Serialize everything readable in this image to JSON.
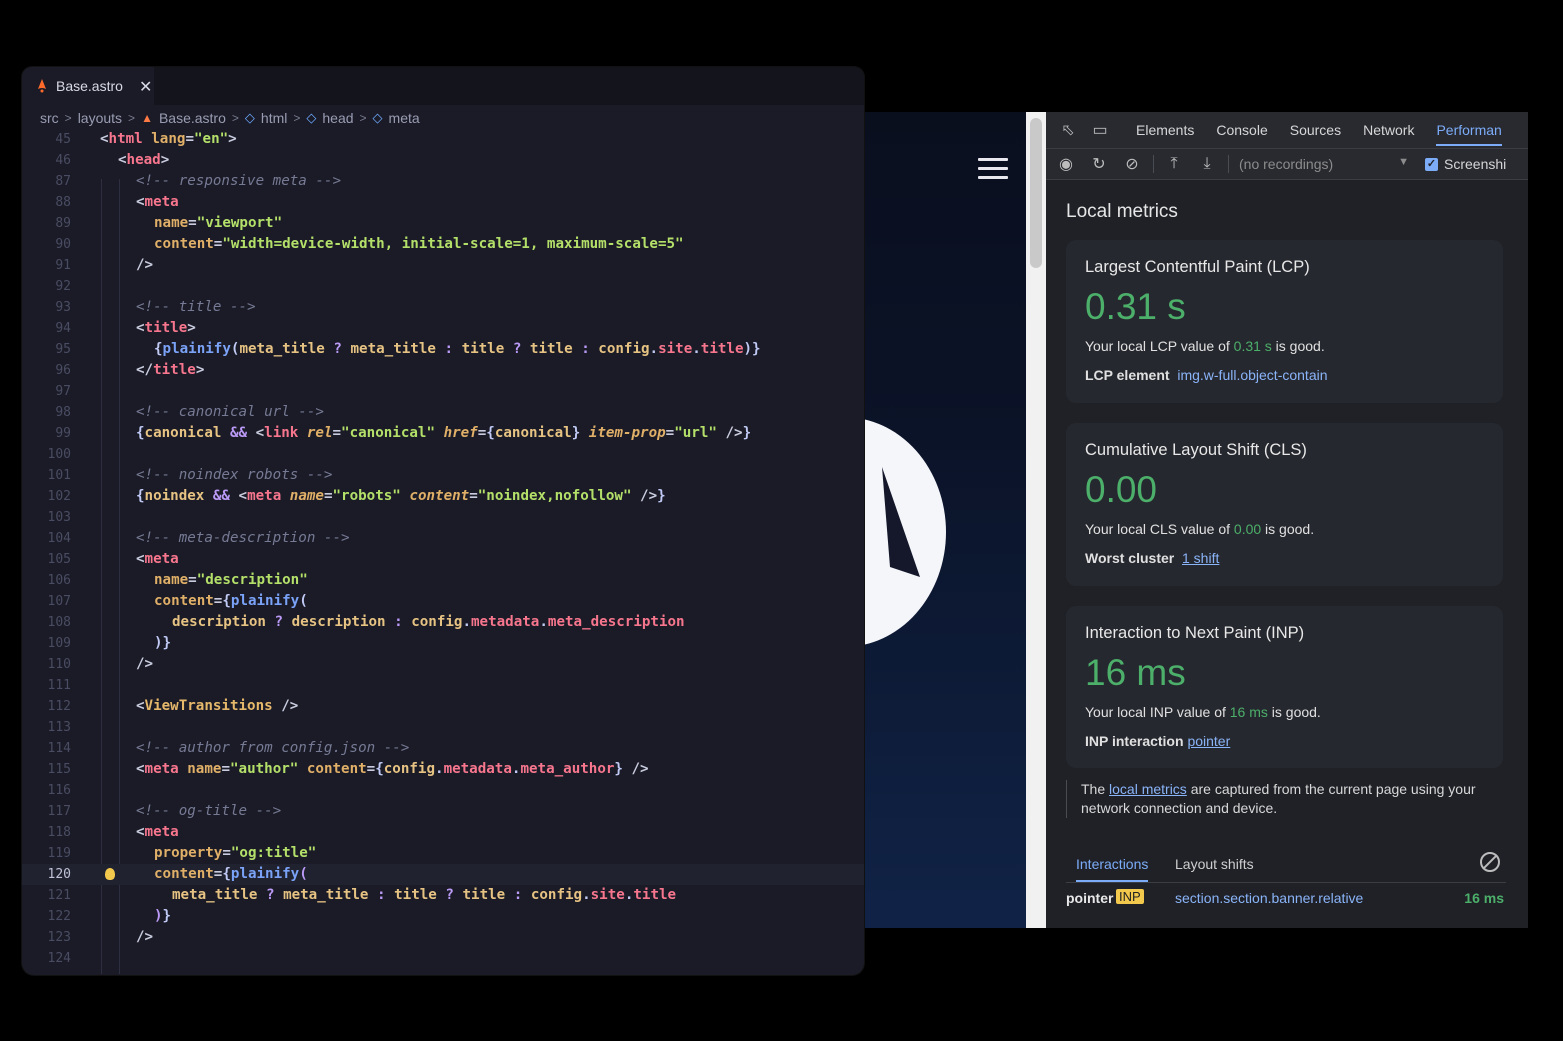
{
  "editor": {
    "tab_label": "Base.astro",
    "tab_close": "✕",
    "breadcrumb": [
      "src",
      "layouts",
      "Base.astro",
      "html",
      "head",
      "meta"
    ],
    "lines": [
      {
        "n": "45",
        "html": "<span class='c-br'>&lt;</span><span class='c-tag'>html</span> <span class='c-attr'>lang</span><span class='c-br'>=</span><span class='c-str'>\"en\"</span><span class='c-br'>&gt;</span>",
        "indent": 0
      },
      {
        "n": "46",
        "html": "<span class='c-br'>&lt;</span><span class='c-tag'>head</span><span class='c-br'>&gt;</span>",
        "indent": 1
      },
      {
        "n": "87",
        "html": "<span class='c-cm'>&lt;!-- responsive meta --&gt;</span>",
        "indent": 2
      },
      {
        "n": "88",
        "html": "<span class='c-br'>&lt;</span><span class='c-tag'>meta</span>",
        "indent": 2
      },
      {
        "n": "89",
        "html": "<span class='c-attr'>name</span><span class='c-br'>=</span><span class='c-str'>\"viewport\"</span>",
        "indent": 3
      },
      {
        "n": "90",
        "html": "<span class='c-attr'>content</span><span class='c-br'>=</span><span class='c-str'>\"width=device-width, initial-scale=1, maximum-scale=5\"</span>",
        "indent": 3
      },
      {
        "n": "91",
        "html": "<span class='c-br'>/&gt;</span>",
        "indent": 2
      },
      {
        "n": "92",
        "html": "",
        "indent": 0
      },
      {
        "n": "93",
        "html": "<span class='c-cm'>&lt;!-- title --&gt;</span>",
        "indent": 2
      },
      {
        "n": "94",
        "html": "<span class='c-br'>&lt;</span><span class='c-tag'>title</span><span class='c-br'>&gt;</span>",
        "indent": 2
      },
      {
        "n": "95",
        "html": "<span class='c-punct'>{</span><span class='c-fn'>plainify</span><span class='c-punct'>(</span><span class='c-var'>meta_title</span> <span class='c-op'>?</span> <span class='c-var'>meta_title</span> <span class='c-op'>:</span> <span class='c-var'>title</span> <span class='c-op'>?</span> <span class='c-var'>title</span> <span class='c-op'>:</span> <span class='c-var'>config</span><span class='c-punct'>.</span><span class='c-prop'>site</span><span class='c-punct'>.</span><span class='c-prop'>title</span><span class='c-punct'>)}</span>",
        "indent": 3
      },
      {
        "n": "96",
        "html": "<span class='c-br'>&lt;/</span><span class='c-tag'>title</span><span class='c-br'>&gt;</span>",
        "indent": 2
      },
      {
        "n": "97",
        "html": "",
        "indent": 0
      },
      {
        "n": "98",
        "html": "<span class='c-cm'>&lt;!-- canonical url --&gt;</span>",
        "indent": 2
      },
      {
        "n": "99",
        "html": "<span class='c-punct'>{</span><span class='c-var'>canonical</span> <span class='c-op'>&amp;&amp;</span> <span class='c-br'>&lt;</span><span class='c-tag'>link</span> <span class='c-it'>rel</span><span class='c-br'>=</span><span class='c-str'>\"canonical\"</span> <span class='c-it'>href</span><span class='c-br'>=</span><span class='c-punct'>{</span><span class='c-var'>canonical</span><span class='c-punct'>}</span> <span class='c-it'>item-prop</span><span class='c-br'>=</span><span class='c-str'>\"url\"</span> <span class='c-br'>/&gt;</span><span class='c-punct'>}</span>",
        "indent": 2
      },
      {
        "n": "100",
        "html": "",
        "indent": 0
      },
      {
        "n": "101",
        "html": "<span class='c-cm'>&lt;!-- noindex robots --&gt;</span>",
        "indent": 2
      },
      {
        "n": "102",
        "html": "<span class='c-punct'>{</span><span class='c-var'>noindex</span> <span class='c-op'>&amp;&amp;</span> <span class='c-br'>&lt;</span><span class='c-tag'>meta</span> <span class='c-it'>name</span><span class='c-br'>=</span><span class='c-str'>\"robots\"</span> <span class='c-it'>content</span><span class='c-br'>=</span><span class='c-str'>\"noindex,nofollow\"</span> <span class='c-br'>/&gt;</span><span class='c-punct'>}</span>",
        "indent": 2
      },
      {
        "n": "103",
        "html": "",
        "indent": 0
      },
      {
        "n": "104",
        "html": "<span class='c-cm'>&lt;!-- meta-description --&gt;</span>",
        "indent": 2
      },
      {
        "n": "105",
        "html": "<span class='c-br'>&lt;</span><span class='c-tag'>meta</span>",
        "indent": 2
      },
      {
        "n": "106",
        "html": "<span class='c-attr'>name</span><span class='c-br'>=</span><span class='c-str'>\"description\"</span>",
        "indent": 3
      },
      {
        "n": "107",
        "html": "<span class='c-attr'>content</span><span class='c-br'>=</span><span class='c-punct'>{</span><span class='c-fn'>plainify</span><span class='c-punct'>(</span>",
        "indent": 3
      },
      {
        "n": "108",
        "html": "<span class='c-var'>description</span> <span class='c-op'>?</span> <span class='c-var'>description</span> <span class='c-op'>:</span> <span class='c-var'>config</span><span class='c-punct'>.</span><span class='c-prop'>metadata</span><span class='c-punct'>.</span><span class='c-prop'>meta_description</span>",
        "indent": 4
      },
      {
        "n": "109",
        "html": "<span class='c-punct'>)}</span>",
        "indent": 3
      },
      {
        "n": "110",
        "html": "<span class='c-br'>/&gt;</span>",
        "indent": 2
      },
      {
        "n": "111",
        "html": "",
        "indent": 0
      },
      {
        "n": "112",
        "html": "<span class='c-br'>&lt;</span><span class='c-jsx'>ViewTransitions</span> <span class='c-br'>/&gt;</span>",
        "indent": 2
      },
      {
        "n": "113",
        "html": "",
        "indent": 0
      },
      {
        "n": "114",
        "html": "<span class='c-cm'>&lt;!-- author from config.json --&gt;</span>",
        "indent": 2
      },
      {
        "n": "115",
        "html": "<span class='c-br'>&lt;</span><span class='c-tag'>meta</span> <span class='c-attr'>name</span><span class='c-br'>=</span><span class='c-str'>\"author\"</span> <span class='c-attr'>content</span><span class='c-br'>=</span><span class='c-punct'>{</span><span class='c-var'>config</span><span class='c-punct'>.</span><span class='c-prop'>metadata</span><span class='c-punct'>.</span><span class='c-prop'>meta_author</span><span class='c-punct'>}</span> <span class='c-br'>/&gt;</span>",
        "indent": 2
      },
      {
        "n": "116",
        "html": "",
        "indent": 0
      },
      {
        "n": "117",
        "html": "<span class='c-cm'>&lt;!-- og-title --&gt;</span>",
        "indent": 2
      },
      {
        "n": "118",
        "html": "<span class='c-br'>&lt;</span><span class='c-tag'>meta</span>",
        "indent": 2
      },
      {
        "n": "119",
        "html": "<span class='c-attr'>property</span><span class='c-br'>=</span><span class='c-str'>\"og:title\"</span>",
        "indent": 3
      },
      {
        "n": "120",
        "html": "<span class='c-attr'>content</span><span class='c-br'>=</span><span class='c-punct'>{</span><span class='c-fn'>plainify</span><span class='c-op'>(</span>",
        "indent": 3,
        "active": true
      },
      {
        "n": "121",
        "html": "<span class='c-var'>meta_title</span> <span class='c-op'>?</span> <span class='c-var'>meta_title</span> <span class='c-op'>:</span> <span class='c-var'>title</span> <span class='c-op'>?</span> <span class='c-var'>title</span> <span class='c-op'>:</span> <span class='c-var'>config</span><span class='c-punct'>.</span><span class='c-prop'>site</span><span class='c-punct'>.</span><span class='c-prop'>title</span>",
        "indent": 4
      },
      {
        "n": "122",
        "html": "<span class='c-op'>)</span><span class='c-punct'>}</span>",
        "indent": 3
      },
      {
        "n": "123",
        "html": "<span class='c-br'>/&gt;</span>",
        "indent": 2
      },
      {
        "n": "124",
        "html": "",
        "indent": 0
      }
    ]
  },
  "devtools": {
    "tabs": [
      "Elements",
      "Console",
      "Sources",
      "Network",
      "Performan"
    ],
    "recordings": "(no recordings)",
    "screenshots_label": "Screenshi",
    "local_metrics_title": "Local metrics",
    "cards": [
      {
        "title": "Largest Contentful Paint (LCP)",
        "value": "0.31 s",
        "desc_pre": "Your local LCP value of ",
        "desc_val": "0.31 s",
        "desc_post": " is good.",
        "extra_label": "LCP element",
        "extra_val": "img.w-full.object-contain",
        "extra_underline": false
      },
      {
        "title": "Cumulative Layout Shift (CLS)",
        "value": "0.00",
        "desc_pre": "Your local CLS value of ",
        "desc_val": "0.00",
        "desc_post": " is good.",
        "extra_label": "Worst cluster",
        "extra_val": "1 shift",
        "extra_underline": true
      },
      {
        "title": "Interaction to Next Paint (INP)",
        "value": "16 ms",
        "desc_pre": "Your local INP value of ",
        "desc_val": "16 ms",
        "desc_post": " is good.",
        "extra_label": "INP interaction",
        "extra_val": "pointer",
        "extra_underline": true
      }
    ],
    "note_pre": "The ",
    "note_link": "local metrics",
    "note_post": " are captured from the current page using your network connection and device.",
    "bottom_tabs": [
      "Interactions",
      "Layout shifts"
    ],
    "row": {
      "type": "pointer",
      "badge": "INP",
      "selector": "section.section.banner.relative",
      "duration": "16 ms"
    }
  }
}
